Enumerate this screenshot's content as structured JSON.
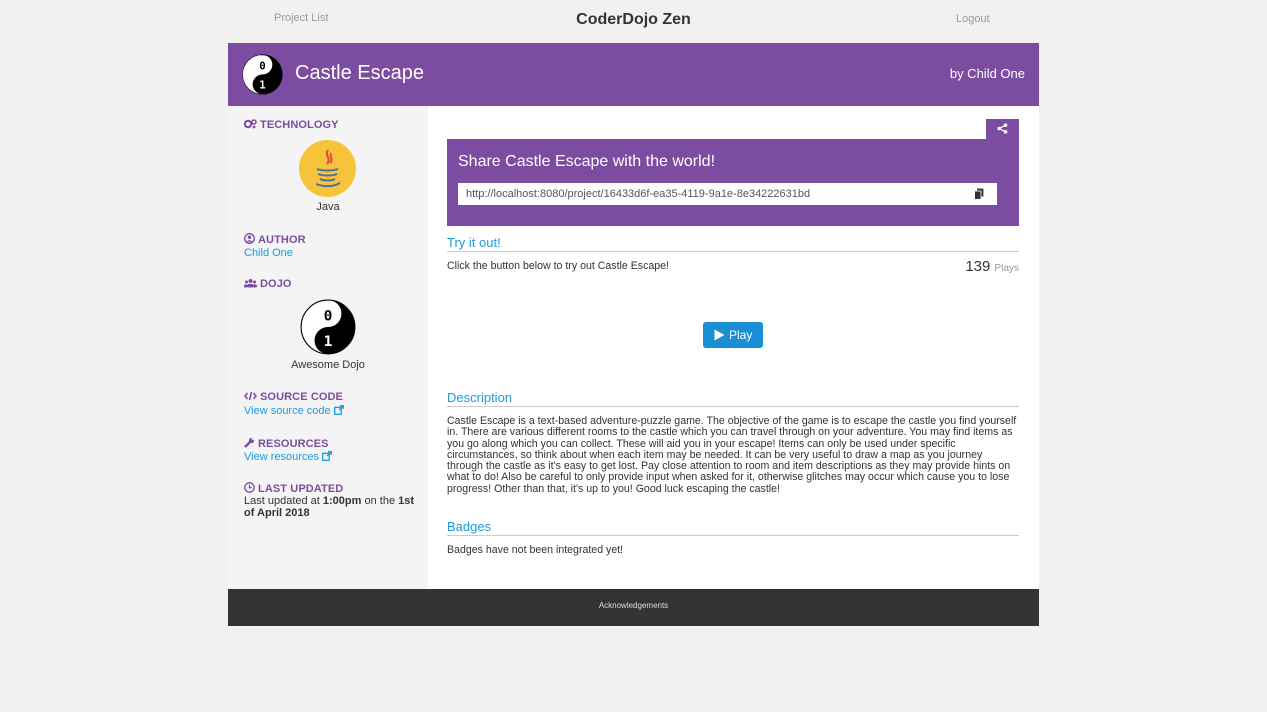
{
  "topnav": {
    "project_list": "Project List",
    "brand": "CoderDojo Zen",
    "logout": "Logout"
  },
  "hero": {
    "title": "Castle Escape",
    "byline": "by Child One"
  },
  "sidebar": {
    "technology": {
      "heading": "TECHNOLOGY",
      "name": "Java",
      "icon": "java-logo"
    },
    "author": {
      "heading": "AUTHOR",
      "name": "Child One"
    },
    "dojo": {
      "heading": "DOJO",
      "name": "Awesome Dojo"
    },
    "source": {
      "heading": "SOURCE CODE",
      "link": "View source code"
    },
    "resources": {
      "heading": "RESOURCES",
      "link": "View resources"
    },
    "updated": {
      "heading": "LAST UPDATED",
      "prefix": "Last updated at ",
      "time": "1:00pm",
      "middle": " on the ",
      "date": "1st of April 2018"
    }
  },
  "share": {
    "title": "Share Castle Escape with the world!",
    "url": "http://localhost:8080/project/16433d6f-ea35-4119-9a1e-8e34222631bd"
  },
  "try": {
    "title": "Try it out!",
    "text": "Click the button below to try out Castle Escape!",
    "plays": "139",
    "plays_label": "Plays",
    "play_label": "Play"
  },
  "description": {
    "title": "Description",
    "lines": [
      "Castle Escape is a text-based adventure-puzzle game. The objective of the game is to escape the castle you find yourself",
      "in. There are various different rooms to the castle which you can travel through on your adventure. You may find items as",
      "you go along which you can collect. These will aid you in your escape! Items can only be used under specific",
      "circumstances, so think about when each item may be needed. It can be very useful to draw a map as you journey",
      "through the castle as it's easy to get lost. Pay close attention to room and item descriptions as they may provide hints on",
      "what to do! Also be careful to only provide input when asked for it, otherwise glitches may occur which cause you to lose",
      "progress! Other than that, it's up to you! Good luck escaping the castle!"
    ]
  },
  "badges": {
    "title": "Badges",
    "text": "Badges have not been integrated yet!"
  },
  "footer": {
    "ack": "Acknowledgements"
  },
  "colors": {
    "purple": "#7b4ca0",
    "link": "#1a9be0",
    "play": "#1a8fd6",
    "footer": "#333333"
  }
}
